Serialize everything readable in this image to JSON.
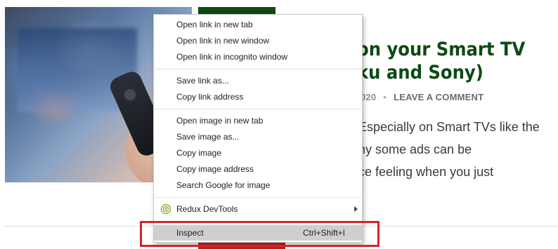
{
  "article": {
    "title": "on your Smart TV\nku and Sony)",
    "meta_date": "020",
    "meta_separator": "•",
    "meta_comment": "LEAVE A COMMENT",
    "excerpt": "Especially on Smart TVs like the\nhy some ads can be\nce feeling when you just"
  },
  "context_menu": {
    "items": [
      {
        "label": "Open link in new tab"
      },
      {
        "label": "Open link in new window"
      },
      {
        "label": "Open link in incognito window"
      },
      {
        "label": "Save link as..."
      },
      {
        "label": "Copy link address"
      },
      {
        "label": "Open image in new tab"
      },
      {
        "label": "Save image as..."
      },
      {
        "label": "Copy image"
      },
      {
        "label": "Copy image address"
      },
      {
        "label": "Search Google for image"
      },
      {
        "label": "Redux DevTools",
        "icon": "redux-devtools-icon",
        "has_submenu": true
      },
      {
        "label": "Inspect",
        "shortcut": "Ctrl+Shift+I",
        "hovered": true
      }
    ]
  },
  "colors": {
    "title_green": "#0d4a12",
    "highlight_red": "#d6212a",
    "hover_gray": "#cfcfcf"
  }
}
